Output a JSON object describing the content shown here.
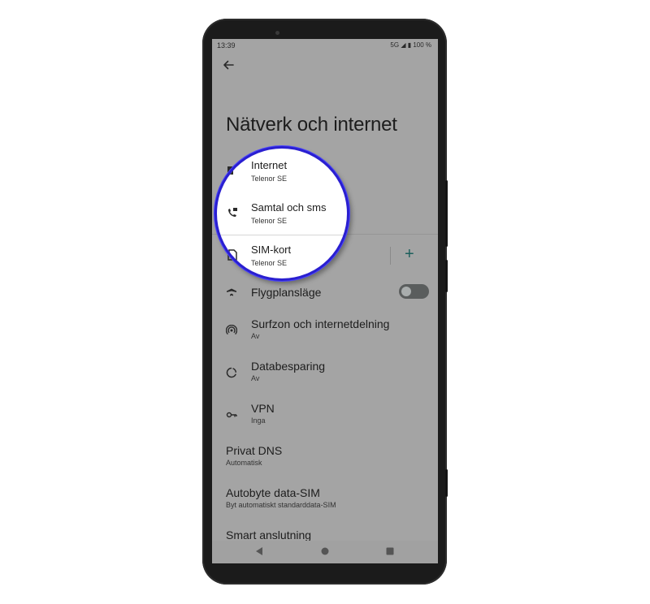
{
  "status_bar": {
    "time": "13:39",
    "indicators": "5G ◢ ▮ 100 %"
  },
  "header": {
    "title": "Nätverk och internet"
  },
  "magnifier_items": [
    {
      "title": "Internet",
      "subtitle": "Telenor SE",
      "icon": "square-icon"
    },
    {
      "title": "Samtal och sms",
      "subtitle": "Telenor SE",
      "icon": "phone-sms-icon"
    },
    {
      "title": "SIM-kort",
      "subtitle": "Telenor SE",
      "icon": "sim-card-icon"
    }
  ],
  "sim_add_label": "+",
  "items": [
    {
      "title": "Flygplansläge",
      "subtitle": "",
      "icon": "airplane-icon"
    },
    {
      "title": "Surfzon och internetdelning",
      "subtitle": "Av",
      "icon": "hotspot-icon"
    },
    {
      "title": "Databesparing",
      "subtitle": "Av",
      "icon": "data-saver-icon"
    },
    {
      "title": "VPN",
      "subtitle": "Inga",
      "icon": "vpn-key-icon"
    },
    {
      "title": "Privat DNS",
      "subtitle": "Automatisk",
      "icon": ""
    },
    {
      "title": "Autobyte data-SIM",
      "subtitle": "Byt automatiskt standarddata-SIM",
      "icon": ""
    },
    {
      "title": "Smart anslutning",
      "subtitle": "",
      "icon": ""
    }
  ],
  "airplane_mode": {
    "on": false
  },
  "colors": {
    "accent": "#1d5f5c",
    "magnifier_ring": "#2a1fd0",
    "scrim": "#a4a4a4"
  }
}
